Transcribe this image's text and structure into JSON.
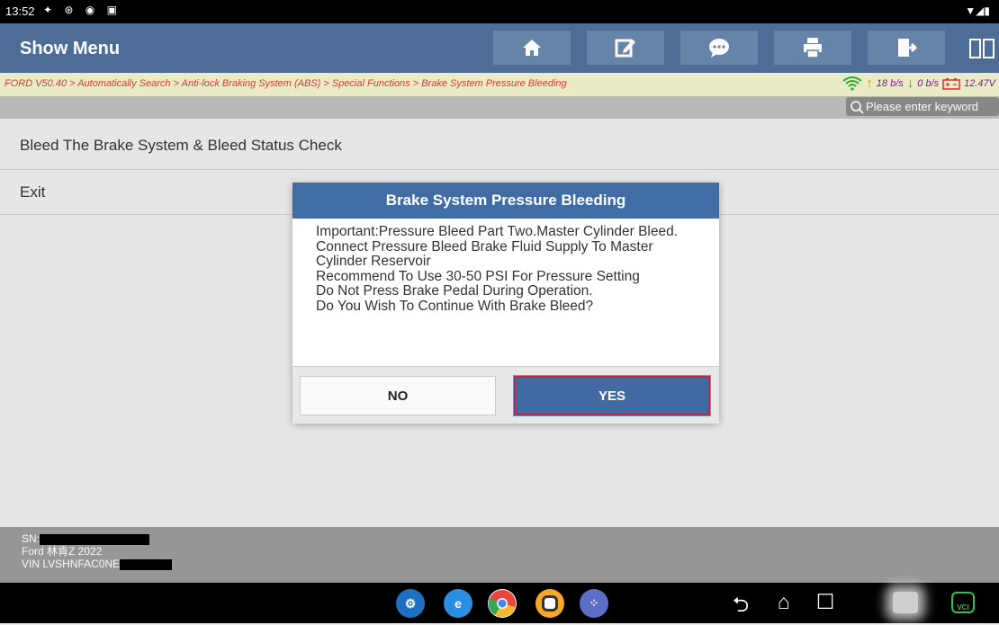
{
  "status_bar": {
    "time": "13:52"
  },
  "header": {
    "title": "Show Menu",
    "buttons": [
      {
        "name": "home-button",
        "icon": "home-icon"
      },
      {
        "name": "edit-button",
        "icon": "edit-icon"
      },
      {
        "name": "chat-button",
        "icon": "chat-icon"
      },
      {
        "name": "print-button",
        "icon": "printer-icon"
      },
      {
        "name": "exit-button",
        "icon": "exit-door-icon"
      }
    ]
  },
  "breadcrumb": "FORD V50.40 > Automatically Search > Anti-lock Braking System (ABS) > Special Functions > Brake System Pressure Bleeding",
  "network": {
    "up": "18 b/s",
    "down": "0 b/s",
    "voltage": "12.47V"
  },
  "search": {
    "placeholder": "Please enter keyword"
  },
  "menu": {
    "items": [
      {
        "label": "Bleed The Brake System & Bleed Status Check"
      },
      {
        "label": "Exit"
      }
    ]
  },
  "footer": {
    "sn_label": "SN:",
    "vehicle": "Ford 林肯Z 2022",
    "vin_label": "VIN LVSHNFAC0NE"
  },
  "dialog": {
    "title": "Brake System Pressure Bleeding",
    "message": "Important:Pressure Bleed Part Two.Master Cylinder Bleed.\nConnect Pressure Bleed Brake Fluid Supply To Master Cylinder Reservoir\nRecommend To Use 30-50 PSI For Pressure Setting\nDo Not Press Brake Pedal During Operation.\nDo You Wish To Continue With Brake Bleed?",
    "no_label": "NO",
    "yes_label": "YES"
  },
  "nav": {
    "apps": [
      "settings-app-icon",
      "browser-app-icon",
      "chrome-app-icon",
      "camera-app-icon",
      "apps-drawer-icon"
    ],
    "buttons": [
      "back-icon",
      "home-icon",
      "recents-icon",
      "gallery-icon",
      "vci-icon"
    ],
    "vci_label": "VCI"
  },
  "colors": {
    "header": "#4f7099",
    "dialog_header": "#426da4",
    "breadcrumb_text": "#d8402c",
    "yes_button": "#436aa2"
  }
}
